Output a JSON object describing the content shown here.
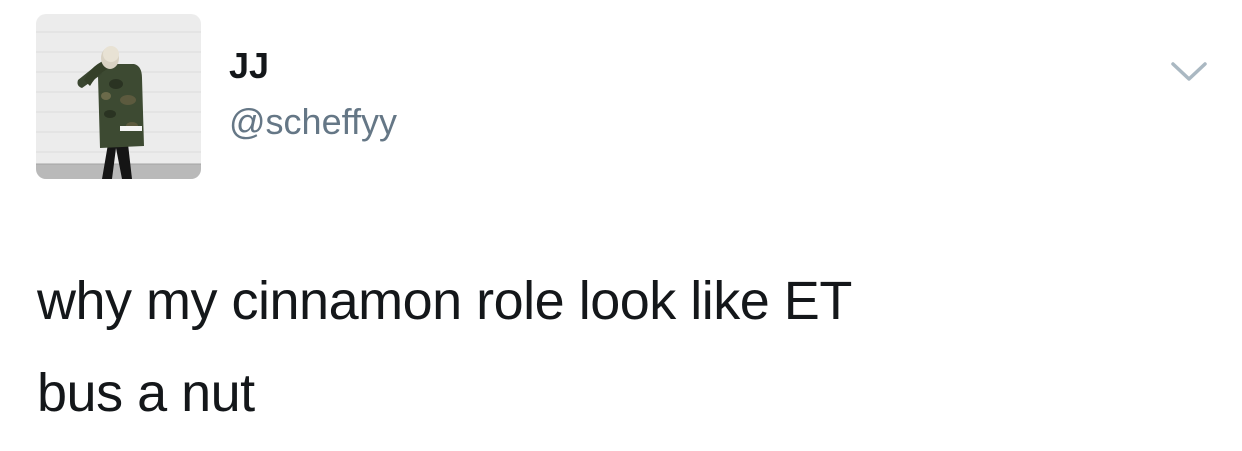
{
  "tweet": {
    "author": {
      "display_name": "JJ",
      "handle": "@scheffyy",
      "avatar_icon": "profile-photo"
    },
    "menu_icon": "chevron-down-icon",
    "text_lines": [
      "why my cinnamon role look like ET",
      "bus a nut"
    ]
  },
  "colors": {
    "text": "#14171a",
    "secondary_text": "#657786",
    "caret": "#aab8c2",
    "background": "#ffffff"
  }
}
